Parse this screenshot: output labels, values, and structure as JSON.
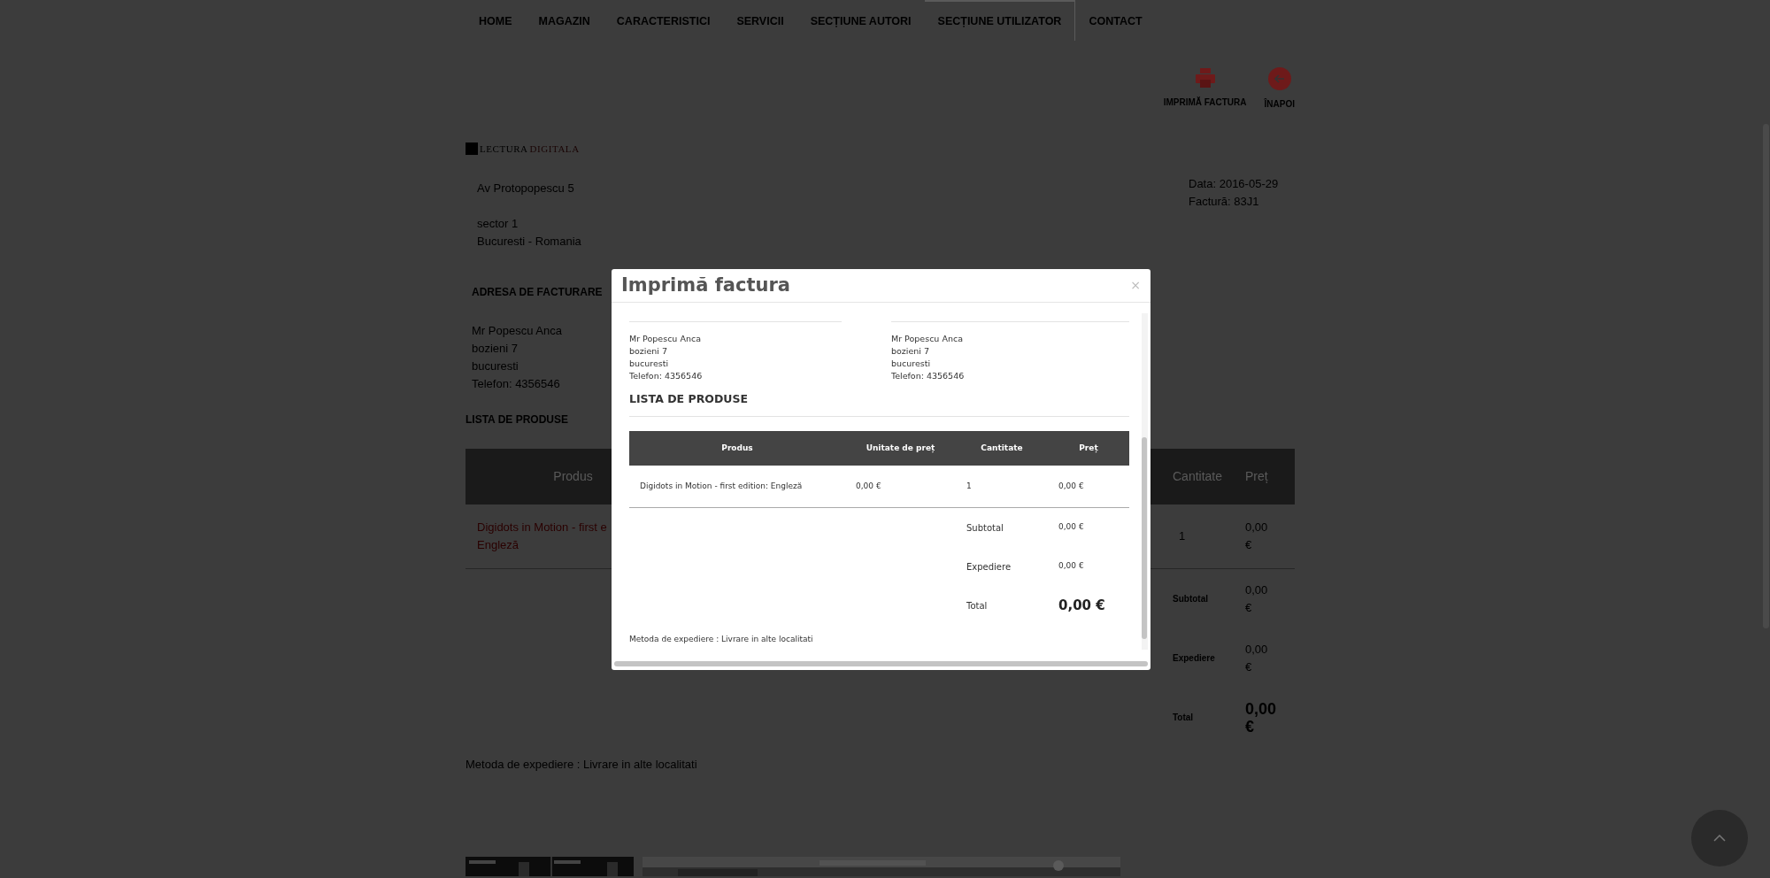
{
  "nav": [
    {
      "label": "HOME",
      "selected": false
    },
    {
      "label": "MAGAZIN",
      "selected": false
    },
    {
      "label": "CARACTERISTICI",
      "selected": false
    },
    {
      "label": "SERVICII",
      "selected": false
    },
    {
      "label": "SECȚIUNE AUTORI",
      "selected": false
    },
    {
      "label": "SECȚIUNE UTILIZATOR",
      "selected": true
    },
    {
      "label": "CONTACT",
      "selected": false
    }
  ],
  "actions": [
    {
      "kind": "print",
      "label": "IMPRIMĂ FACTURA"
    },
    {
      "kind": "back",
      "label": "ÎNAPOI"
    }
  ],
  "logo": {
    "part_1": "LECTURA",
    "part_2": "DIGITALA"
  },
  "shop_address": [
    [
      "Av Protopopescu 5"
    ],
    [
      "sector 1",
      "Bucuresti - Romania"
    ]
  ],
  "invoice_meta": [
    "Data: 2016-05-29",
    "Factură: 83J1"
  ],
  "billing_heading": "ADRESA DE FACTURARE",
  "billing_address": [
    "Mr Popescu Anca",
    "bozieni 7",
    "bucuresti",
    "Telefon: 4356546"
  ],
  "products_heading": "LISTA DE PRODUSE",
  "table": {
    "columns": [
      "Produs",
      "Cantitate",
      "Preț"
    ],
    "rows": [
      {
        "product": [
          "Digidots in Motion - first e",
          "Engleză"
        ],
        "quantity": "1",
        "price": "0,00 €"
      }
    ],
    "totals": [
      {
        "label": "Subtotal",
        "value": "0,00 €"
      },
      {
        "label": "Expediere",
        "value": "0,00 €"
      },
      {
        "label": "Total",
        "value": "0,00 €"
      }
    ]
  },
  "shipping_method": "Metoda de expediere : Livrare in alte localitati",
  "footer_pictures": [
    {
      "kind": "picture"
    },
    {
      "kind": "picture"
    }
  ],
  "modal": {
    "title": "Imprimă factura",
    "close": "×",
    "addresses": [
      [
        "Mr Popescu Anca",
        "bozieni 7",
        "bucuresti",
        "Telefon: 4356546"
      ],
      [
        "Mr Popescu Anca",
        "bozieni 7",
        "bucuresti",
        "Telefon: 4356546"
      ]
    ],
    "products_heading": "LISTA DE PRODUSE",
    "columns": [
      "Produs",
      "Unitate de preț",
      "Cantitate",
      "Preț"
    ],
    "rows": [
      [
        "Digidots in Motion - first edition: Engleză",
        "0,00 €",
        "1",
        "0,00 €"
      ]
    ],
    "totals": [
      {
        "label": "Subtotal",
        "value": "0,00 €"
      },
      {
        "label": "Expediere",
        "value": "0,00 €"
      },
      {
        "label": "Total",
        "value": "0,00 €"
      }
    ],
    "shipping_method": "Metoda de expediere : Livrare in alte localitati"
  }
}
